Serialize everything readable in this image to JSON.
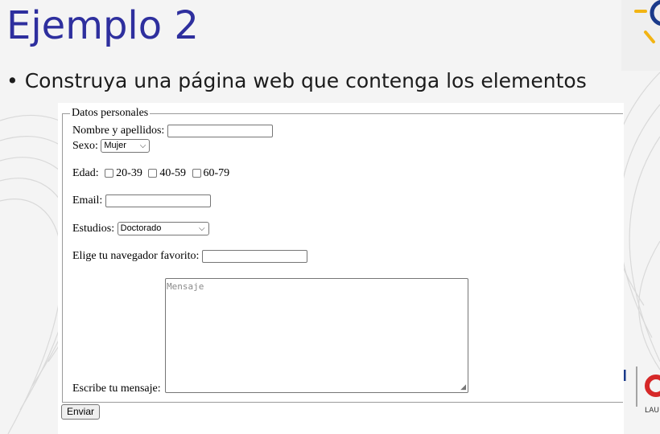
{
  "slide": {
    "title": "Ejemplo 2",
    "bullet_marker": "•",
    "bullet_text": "Construya una página web que contenga los elementos",
    "logo_caption": "LAU"
  },
  "form": {
    "legend": "Datos personales",
    "name_label": "Nombre y apellidos:",
    "sex_label": "Sexo:",
    "sex_value": "Mujer",
    "age_label": "Edad:",
    "age_options": [
      "20-39",
      "40-59",
      "60-79"
    ],
    "email_label": "Email:",
    "studies_label": "Estudios:",
    "studies_value": "Doctorado",
    "browser_label": "Elige tu navegador favorito:",
    "message_label": "Escribe tu mensaje:",
    "message_placeholder": "Mensaje",
    "submit_label": "Enviar"
  },
  "colors": {
    "title": "#2e2f9e",
    "logo_blue": "#1a3a8a",
    "logo_yellow": "#f2b413",
    "logo_red": "#d62828"
  },
  "icons": [
    "chevron-down-icon",
    "resize-grip-icon",
    "brand-logo-icon"
  ]
}
